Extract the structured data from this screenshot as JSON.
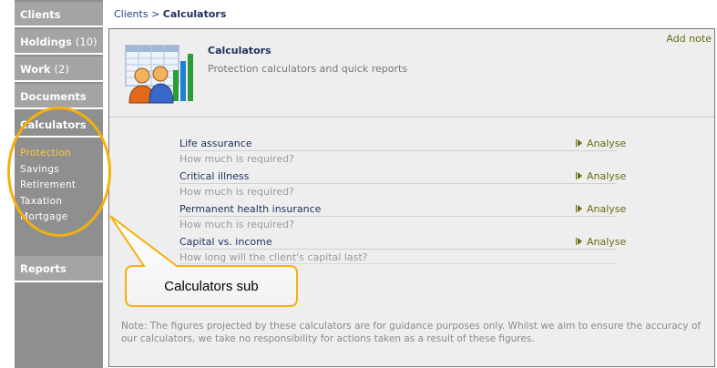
{
  "sidebar": {
    "items": [
      {
        "label": "Clients",
        "count": ""
      },
      {
        "label": "Holdings",
        "count": "(10)"
      },
      {
        "label": "Work",
        "count": "(2)"
      },
      {
        "label": "Documents",
        "count": ""
      },
      {
        "label": "Calculators",
        "count": ""
      },
      {
        "label": "Reports",
        "count": ""
      }
    ],
    "sub_items": [
      "Protection",
      "Savings",
      "Retirement",
      "Taxation",
      "Mortgage"
    ]
  },
  "breadcrumb": {
    "link": "Clients",
    "separator": ">",
    "current": "Calculators"
  },
  "header": {
    "title": "Calculators",
    "subtitle": "Protection calculators and quick reports",
    "add_note": "Add note"
  },
  "calculators": [
    {
      "name": "Life assurance",
      "description": "How much is required?",
      "action": "Analyse"
    },
    {
      "name": "Critical illness",
      "description": "How much is required?",
      "action": "Analyse"
    },
    {
      "name": "Permanent health insurance",
      "description": "How much is required?",
      "action": "Analyse"
    },
    {
      "name": "Capital vs. income",
      "description": "How long will the client's capital last?",
      "action": "Analyse"
    }
  ],
  "note": "Note:  The figures projected by these calculators are for guidance purposes only.  Whilst we aim to ensure the accuracy of our calculators, we take no responsibility for actions taken as a result of these figures.",
  "annotation": {
    "callout_text": "Calculators sub"
  },
  "colors": {
    "sidebar_bg": "#8f8f8f",
    "nav_item_bg": "#a4a4a4",
    "active_sub": "#ffcc33",
    "link_blue": "#23418a",
    "analyse_olive": "#6b6b10",
    "annotation_orange": "#f4b10b"
  }
}
